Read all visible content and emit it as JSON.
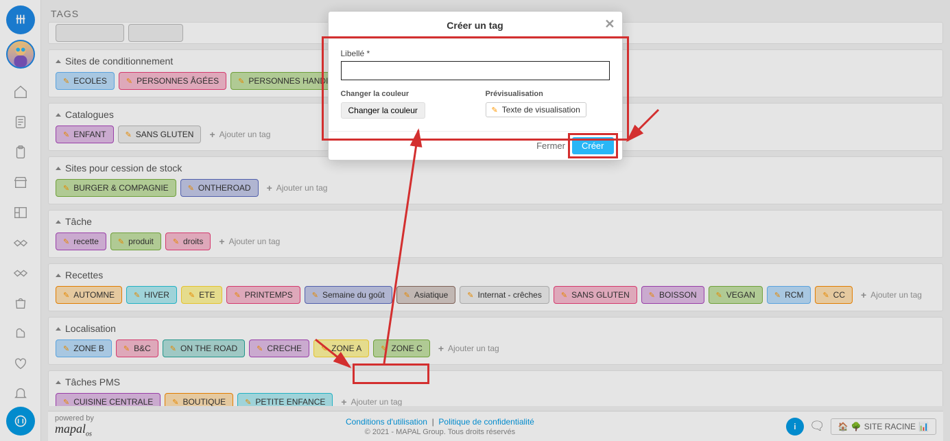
{
  "page": {
    "title": "TAGS"
  },
  "sidebar": {
    "nav": [
      "home",
      "doc",
      "clipboard",
      "store",
      "layout",
      "hand1",
      "hand2",
      "bag",
      "chef",
      "heart",
      "bell"
    ]
  },
  "groups": [
    {
      "title": "Sites de conditionnement",
      "tags": [
        {
          "label": "ECOLES",
          "color": "c-blue-light"
        },
        {
          "label": "PERSONNES ÂGÉES",
          "color": "c-pink"
        },
        {
          "label": "PERSONNES HANDICAPÉ",
          "color": "c-green"
        }
      ],
      "showAdd": false
    },
    {
      "title": "Catalogues",
      "tags": [
        {
          "label": "ENFANT",
          "color": "c-purple"
        },
        {
          "label": "SANS GLUTEN",
          "color": "c-grey"
        }
      ],
      "showAdd": true
    },
    {
      "title": "Sites pour cession de stock",
      "tags": [
        {
          "label": "BURGER & COMPAGNIE",
          "color": "c-green"
        },
        {
          "label": "ONTHEROAD",
          "color": "c-purple-blue"
        }
      ],
      "showAdd": true
    },
    {
      "title": "Tâche",
      "tags": [
        {
          "label": "recette",
          "color": "c-purple"
        },
        {
          "label": "produit",
          "color": "c-green"
        },
        {
          "label": "droits",
          "color": "c-pink"
        }
      ],
      "showAdd": true
    },
    {
      "title": "Recettes",
      "tags": [
        {
          "label": "AUTOMNE",
          "color": "c-orange"
        },
        {
          "label": "HIVER",
          "color": "c-cyan"
        },
        {
          "label": "ETE",
          "color": "c-yellow"
        },
        {
          "label": "PRINTEMPS",
          "color": "c-pink"
        },
        {
          "label": "Semaine du goût",
          "color": "c-purple-blue"
        },
        {
          "label": "Asiatique",
          "color": "c-brown"
        },
        {
          "label": "Internat - crêches",
          "color": "c-grey"
        },
        {
          "label": "SANS GLUTEN",
          "color": "c-pink"
        },
        {
          "label": "BOISSON",
          "color": "c-purple"
        },
        {
          "label": "VEGAN",
          "color": "c-green"
        },
        {
          "label": "RCM",
          "color": "c-blue-light"
        },
        {
          "label": "CC",
          "color": "c-orange"
        }
      ],
      "showAdd": true
    },
    {
      "title": "Localisation",
      "tags": [
        {
          "label": "ZONE B",
          "color": "c-blue-light"
        },
        {
          "label": "B&C",
          "color": "c-pink"
        },
        {
          "label": "ON THE ROAD",
          "color": "c-teal"
        },
        {
          "label": "CRECHE",
          "color": "c-purple"
        },
        {
          "label": "ZONE A",
          "color": "c-yellow"
        },
        {
          "label": "ZONE C",
          "color": "c-green"
        }
      ],
      "showAdd": true
    },
    {
      "title": "Tâches PMS",
      "tags": [
        {
          "label": "CUISINE CENTRALE",
          "color": "c-purple"
        },
        {
          "label": "BOUTIQUE",
          "color": "c-orange"
        },
        {
          "label": "PETITE ENFANCE",
          "color": "c-cyan"
        }
      ],
      "showAdd": true
    }
  ],
  "addTagLabel": "Ajouter un tag",
  "modal": {
    "title": "Créer un tag",
    "fieldLabel": "Libellé *",
    "fieldValue": "",
    "colorHead": "Changer la couleur",
    "colorBtn": "Changer la couleur",
    "previewHead": "Prévisualisation",
    "previewText": "Texte de visualisation",
    "closeBtn": "Fermer",
    "createBtn": "Créer"
  },
  "footer": {
    "poweredBy": "powered by",
    "brand": "mapal",
    "brandSuffix": "os",
    "terms": "Conditions d'utilisation",
    "privacy": "Politique de confidentialité",
    "copyright": "© 2021 - MAPAL Group. Tous droits réservés",
    "siteBtn": "SITE RACINE"
  }
}
